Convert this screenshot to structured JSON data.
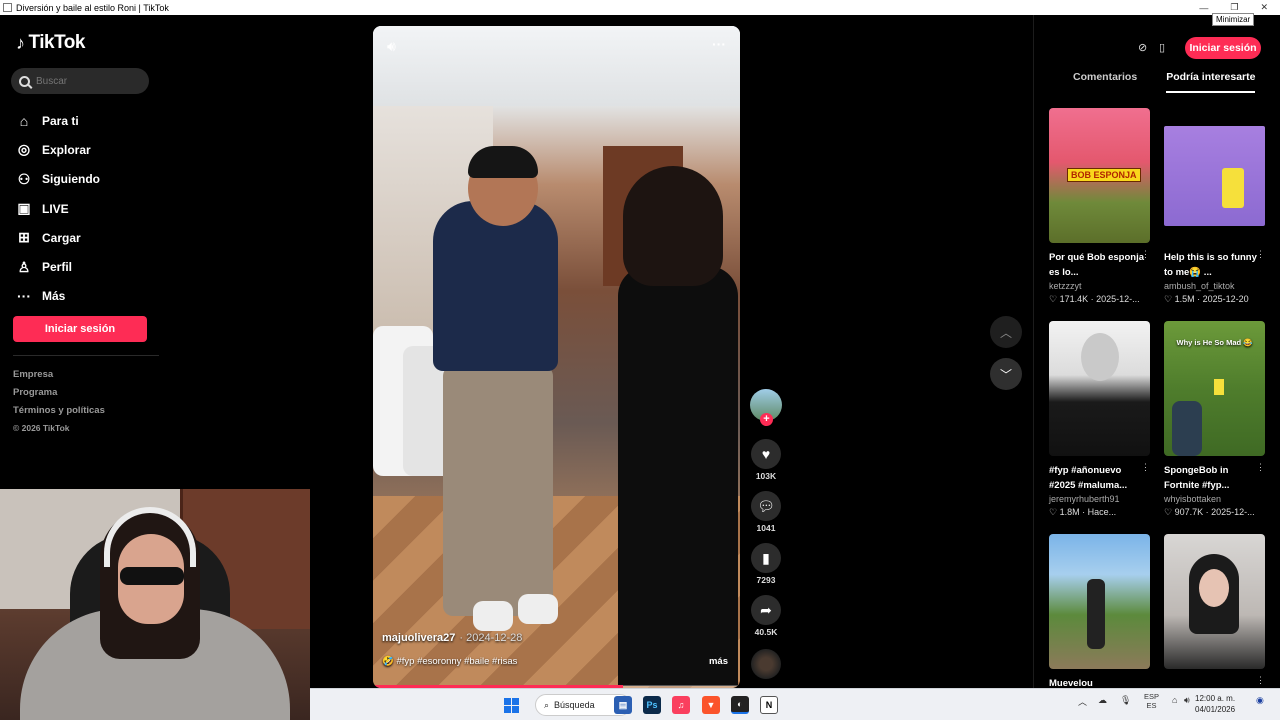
{
  "window": {
    "title": "Diversión y baile al estilo Roni | TikTok",
    "tooltip": "Minimizar"
  },
  "sidebar": {
    "logo": "TikTok",
    "search_placeholder": "Buscar",
    "items": [
      {
        "label": "Para ti",
        "icon": "home-icon"
      },
      {
        "label": "Explorar",
        "icon": "compass-icon"
      },
      {
        "label": "Siguiendo",
        "icon": "following-icon"
      },
      {
        "label": "LIVE",
        "icon": "live-icon"
      },
      {
        "label": "Cargar",
        "icon": "upload-icon"
      },
      {
        "label": "Perfil",
        "icon": "profile-icon"
      },
      {
        "label": "Más",
        "icon": "more-icon"
      }
    ],
    "login_label": "Iniciar sesión",
    "footer": [
      "Empresa",
      "Programa",
      "Términos y políticas",
      "© 2026 TikTok"
    ]
  },
  "video": {
    "author": "majuolivera27",
    "date": "2024-12-28",
    "caption": "🤣 #fyp #esoronny #baile #risas",
    "more": "más",
    "progress": 0.68
  },
  "actions": {
    "likes": "103K",
    "comments": "1041",
    "saves": "7293",
    "shares": "40.5K"
  },
  "right_panel": {
    "login_label": "Iniciar sesión",
    "tabs": [
      "Comentarios",
      "Podría interesarte"
    ],
    "active_tab": 1,
    "cards": [
      {
        "title": "Por qué Bob esponja es lo...",
        "author": "ketzzzyt",
        "meta": "♡ 171.4K · 2025-12-...",
        "thumb_text": "BOB ESPONJA"
      },
      {
        "title": "Help this is so funny to me😭 ...",
        "author": "ambush_of_tiktok",
        "meta": "♡ 1.5M · 2025-12-20",
        "thumb_text": ""
      },
      {
        "title": "#fyp #añonuevo #2025 #maluma...",
        "author": "jeremyrhuberth91",
        "meta": "♡ 1.8M · Hace...",
        "thumb_text": ""
      },
      {
        "title": "SpongeBob in Fortnite #fyp...",
        "author": "whyisbottaken",
        "meta": "♡ 907.7K · 2025-12-...",
        "thumb_text": "Why is He So Mad 😂"
      },
      {
        "title": "Muevelou",
        "author": "",
        "meta": "",
        "thumb_text": ""
      },
      {
        "title": "",
        "author": "",
        "meta": "",
        "thumb_text": ""
      }
    ]
  },
  "taskbar": {
    "search": "Búsqueda",
    "lang": "ESP",
    "lang2": "ES",
    "time": "12:00 a. m.",
    "date": "04/01/2026"
  },
  "colors": {
    "accent": "#fe2c55",
    "background": "#000000"
  }
}
